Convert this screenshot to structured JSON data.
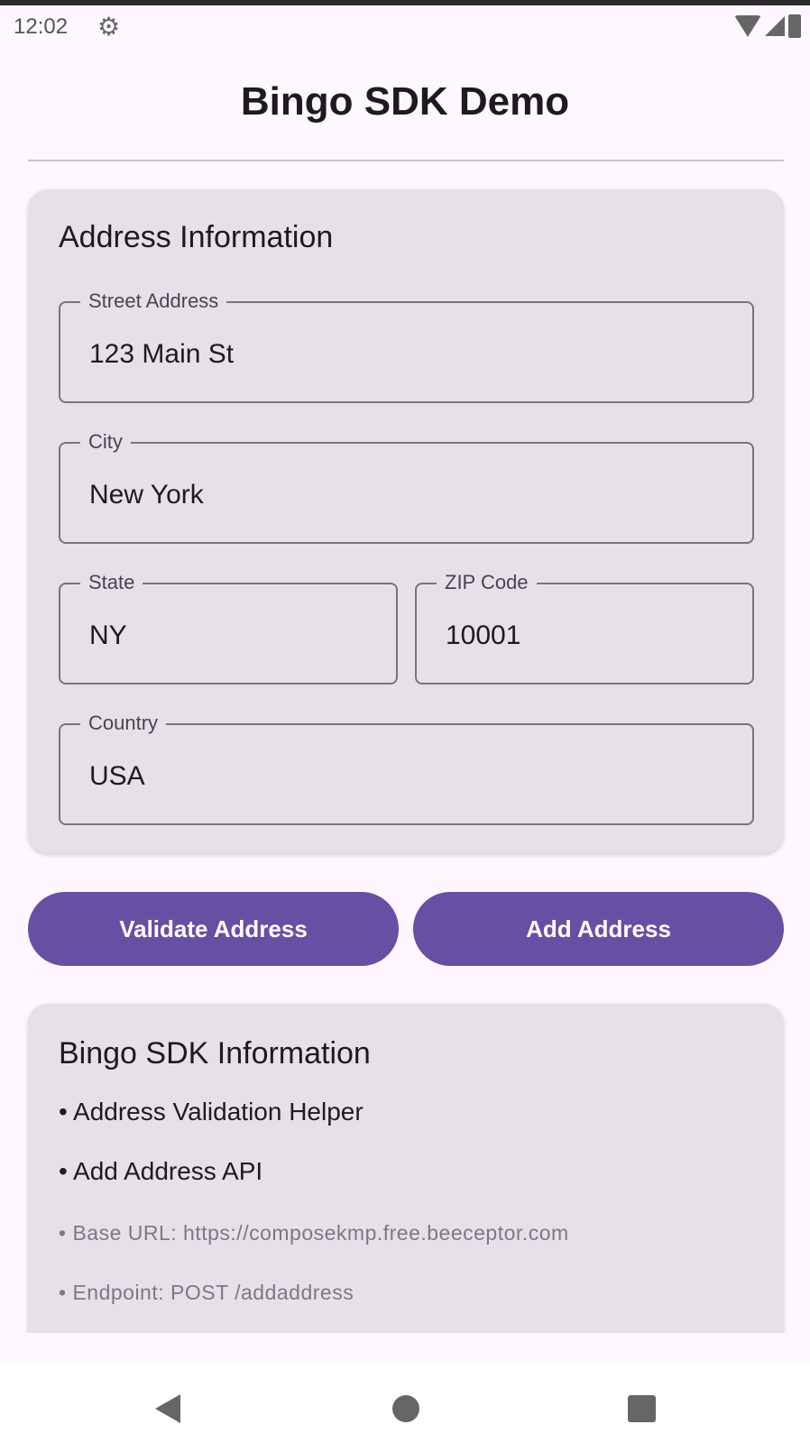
{
  "status_bar": {
    "time": "12:02",
    "icons": [
      "gear-icon",
      "wifi-icon",
      "signal-icon",
      "battery-icon"
    ]
  },
  "header": {
    "title": "Bingo SDK Demo"
  },
  "address_card": {
    "title": "Address Information",
    "fields": {
      "street": {
        "label": "Street Address",
        "value": "123 Main St"
      },
      "city": {
        "label": "City",
        "value": "New York"
      },
      "state": {
        "label": "State",
        "value": "NY"
      },
      "zip": {
        "label": "ZIP Code",
        "value": "10001"
      },
      "country": {
        "label": "Country",
        "value": "USA"
      }
    }
  },
  "buttons": {
    "validate": "Validate Address",
    "add": "Add Address"
  },
  "info_card": {
    "title": "Bingo SDK Information",
    "items": [
      "• Address Validation Helper",
      "• Add Address API",
      "• Base URL: https://composekmp.free.beeceptor.com",
      "• Endpoint: POST /addaddress"
    ]
  },
  "colors": {
    "primary": "#674fa3",
    "card": "#e6e0e9",
    "background": "#fef7ff"
  }
}
